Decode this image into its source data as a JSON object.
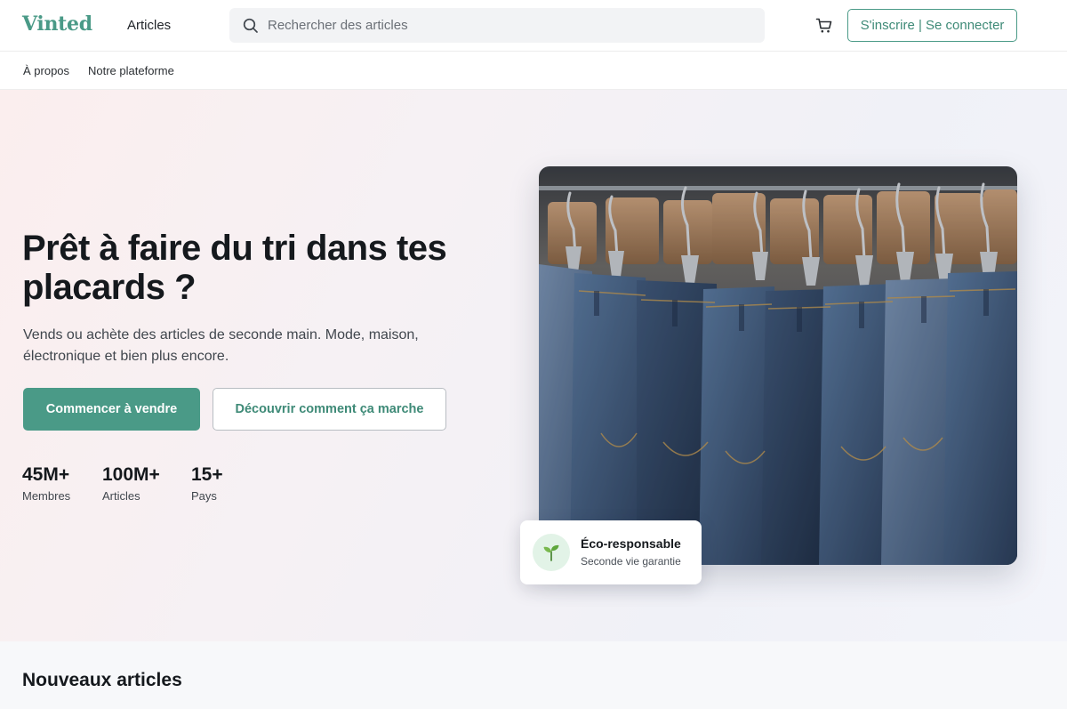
{
  "header": {
    "logo": "Vinted",
    "nav_articles": "Articles",
    "search_placeholder": "Rechercher des articles",
    "auth_label": "S'inscrire | Se connecter"
  },
  "subnav": {
    "items": [
      "À propos",
      "Notre plateforme"
    ]
  },
  "hero": {
    "title": "Prêt à faire du tri dans tes placards ?",
    "subtitle": "Vends ou achète des articles de seconde main. Mode, maison, électronique et bien plus encore.",
    "primary_cta": "Commencer à vendre",
    "secondary_cta": "Découvrir comment ça marche",
    "stats": [
      {
        "value": "45M+",
        "label": "Membres"
      },
      {
        "value": "100M+",
        "label": "Articles"
      },
      {
        "value": "15+",
        "label": "Pays"
      }
    ]
  },
  "eco_card": {
    "title": "Éco-responsable",
    "subtitle": "Seconde vie garantie",
    "icon": "sprout-icon"
  },
  "new_articles": {
    "title": "Nouveaux articles"
  },
  "colors": {
    "brand": "#4a9a87",
    "text": "#15191d"
  }
}
